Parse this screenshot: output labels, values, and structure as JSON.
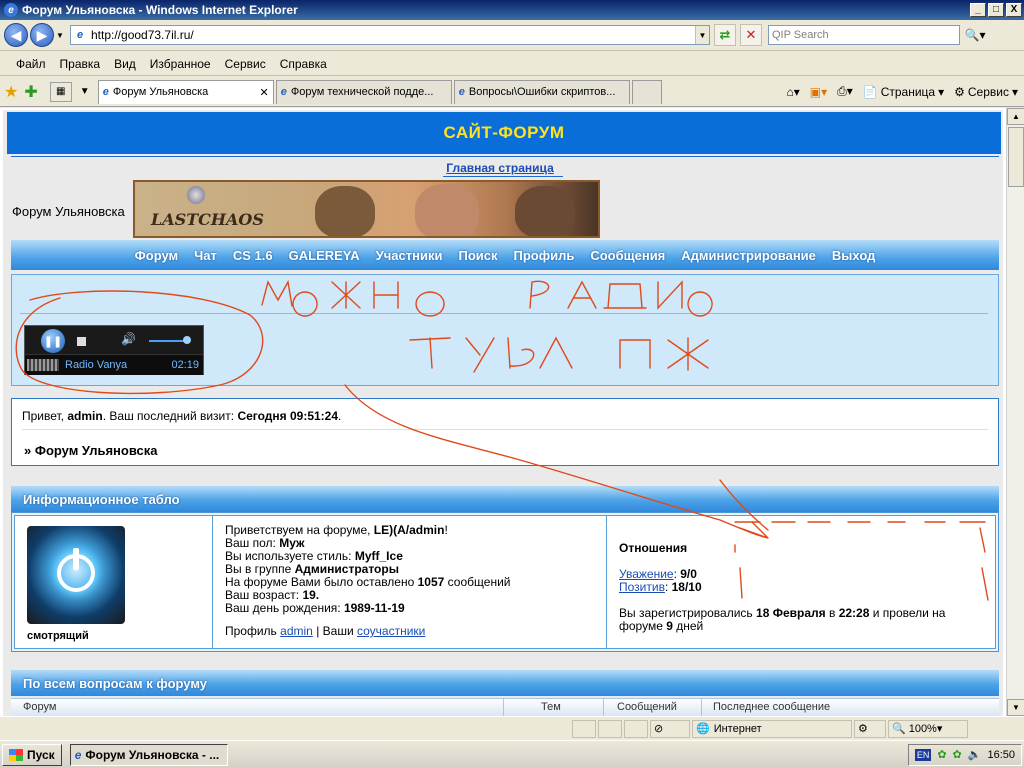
{
  "window": {
    "title": "Форум Ульяновска - Windows Internet Explorer",
    "minimize": "_",
    "maximize": "□",
    "close": "X"
  },
  "address_bar": {
    "url": "http://good73.7il.ru/",
    "search_placeholder": "QIP Search"
  },
  "menu": [
    "Файл",
    "Правка",
    "Вид",
    "Избранное",
    "Сервис",
    "Справка"
  ],
  "tabs": [
    {
      "label": "Форум Ульяновска",
      "active": true
    },
    {
      "label": "Форум технической подде...",
      "active": false
    },
    {
      "label": "Вопросы\\Ошибки скриптов...",
      "active": false
    }
  ],
  "commandbar": {
    "page_label": "Страница",
    "tools_label": "Сервис"
  },
  "page": {
    "header_title": "САЙТ-ФОРУМ",
    "main_link": "Главная страница",
    "site_name": "Форум Ульяновска",
    "banner_text": "LASTCHAOS",
    "nav_items": [
      "Форум",
      "Чат",
      "CS 1.6",
      "GALEREYA",
      "Участники",
      "Поиск",
      "Профиль",
      "Сообщения",
      "Администрирование",
      "Выход"
    ],
    "player": {
      "station": "Radio Vanya",
      "time": "02:19"
    },
    "welcome": {
      "hello": "Привет,",
      "user": "admin",
      "last_visit_label": ". Ваш последний визит:",
      "last_visit_value": "Сегодня 09:51:24",
      "breadcrumb": "» Форум Ульяновска"
    },
    "info_board": {
      "title": "Информационное табло",
      "avatar_caption": "смотрящий",
      "lines": {
        "greeting_prefix": "Приветствуем на форуме,",
        "greeting_user": "LE)(A/admin",
        "gender_label": "Ваш пол:",
        "gender_value": "Муж",
        "style_label": "Вы используете стиль:",
        "style_value": "Myff_Ice",
        "group_label": "Вы в группе",
        "group_value": "Администраторы",
        "posts_label": "На форуме Вами было оставлено",
        "posts_value": "1057",
        "posts_suffix": "сообщений",
        "age_label": "Ваш возраст:",
        "age_value": "19.",
        "birthday_label": "Ваш день рождения:",
        "birthday_value": "1989-11-19",
        "profile_label": "Профиль",
        "profile_link": "admin",
        "participants_label": "| Ваши",
        "participants_link": "соучастники"
      },
      "relations": {
        "title": "Отношения",
        "respect_label": "Уважение",
        "respect_value": "9/0",
        "positive_label": "Позитив",
        "positive_value": "18/10",
        "registered_prefix": "Вы зарегистрировались",
        "registered_date": "18 Февраля",
        "registered_at": "в",
        "registered_time": "22:28",
        "spent_prefix": "и провели на форуме",
        "spent_days": "9",
        "spent_suffix": "дней"
      }
    },
    "categories": {
      "title": "По всем вопросам к форуму",
      "col_forum": "Форум",
      "col_topics": "Тем",
      "col_posts": "Сообщений",
      "col_last": "Последнее сообщение"
    }
  },
  "statusbar": {
    "zone": "Интернет",
    "zoom": "100%"
  },
  "taskbar": {
    "start": "Пуск",
    "task": "Форум Ульяновска - ...",
    "lang": "EN",
    "clock": "16:50"
  }
}
